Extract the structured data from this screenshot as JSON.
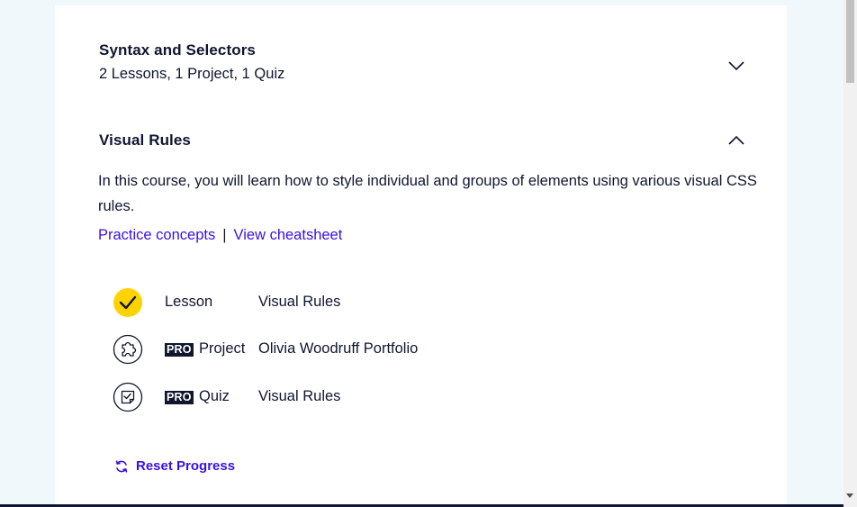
{
  "sections": [
    {
      "title": "Syntax and Selectors",
      "subtitle": "2 Lessons, 1 Project, 1 Quiz",
      "expanded": false
    },
    {
      "title": "Visual Rules",
      "expanded": true
    }
  ],
  "visual_rules": {
    "description": "In this course, you will learn how to style individual and groups of elements using various visual CSS rules.",
    "practice_link": "Practice concepts",
    "separator": "|",
    "cheatsheet_link": "View cheatsheet",
    "items": [
      {
        "type": "Lesson",
        "name": "Visual Rules",
        "pro": false,
        "icon": "check-circle-icon",
        "completed": true
      },
      {
        "type": "Project",
        "name": "Olivia Woodruff Portfolio",
        "pro": true,
        "pro_label": "PRO",
        "icon": "puzzle-icon",
        "completed": false
      },
      {
        "type": "Quiz",
        "name": "Visual Rules",
        "pro": true,
        "pro_label": "PRO",
        "icon": "quiz-icon",
        "completed": false
      }
    ],
    "reset_label": "Reset Progress"
  },
  "colors": {
    "accent": "#3a10e5",
    "navy": "#10162f",
    "complete": "#ffd300",
    "background": "#f1f8fc"
  }
}
